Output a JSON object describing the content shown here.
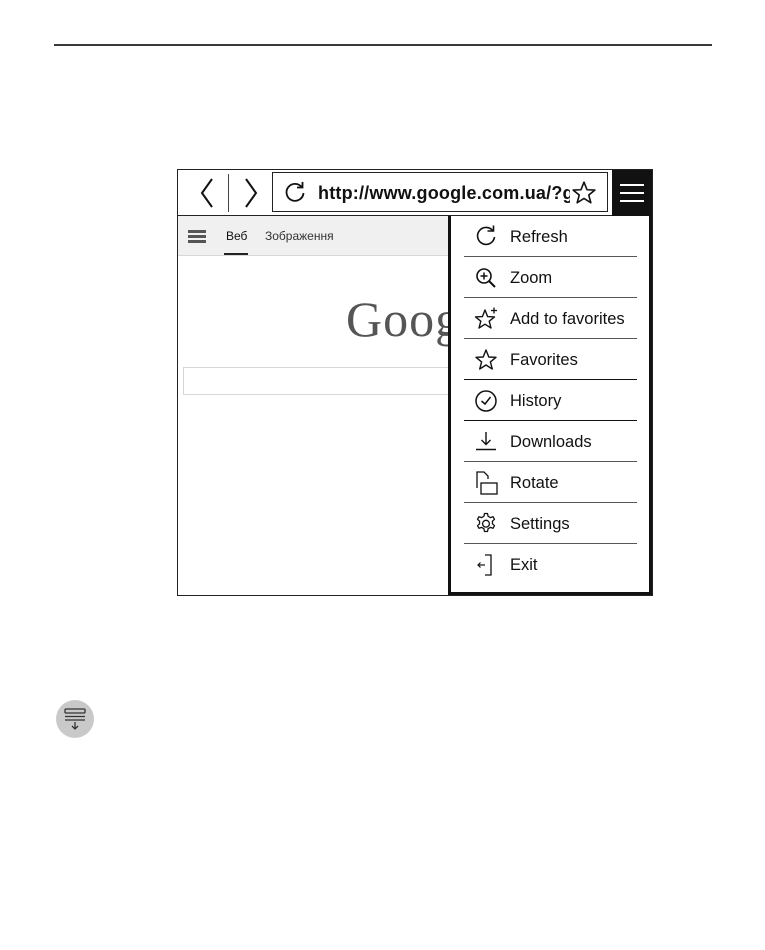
{
  "toolbar": {
    "url": "http://www.google.com.ua/?g",
    "icons": {
      "back": "chevron-left-icon",
      "forward": "chevron-right-icon",
      "refresh": "refresh-icon",
      "bookmark": "star-icon",
      "menu": "hamburger-menu-icon"
    }
  },
  "page": {
    "tabs": [
      "Веб",
      "Зображення"
    ],
    "logo_text": "Goog"
  },
  "menu": {
    "items": [
      {
        "label": "Refresh",
        "icon": "refresh-icon"
      },
      {
        "label": "Zoom",
        "icon": "zoom-in-icon"
      },
      {
        "label": "Add to favorites",
        "icon": "add-star-icon"
      },
      {
        "label": "Favorites",
        "icon": "star-icon"
      },
      {
        "label": "History",
        "icon": "clock-icon"
      },
      {
        "label": "Downloads",
        "icon": "download-icon"
      },
      {
        "label": "Rotate",
        "icon": "rotate-icon"
      },
      {
        "label": "Settings",
        "icon": "gear-icon"
      },
      {
        "label": "Exit",
        "icon": "exit-icon"
      }
    ]
  },
  "colors": {
    "ink": "#111111",
    "google_bar": "#f0f0f0",
    "bottom_icon_bg": "#c9c9c9"
  }
}
